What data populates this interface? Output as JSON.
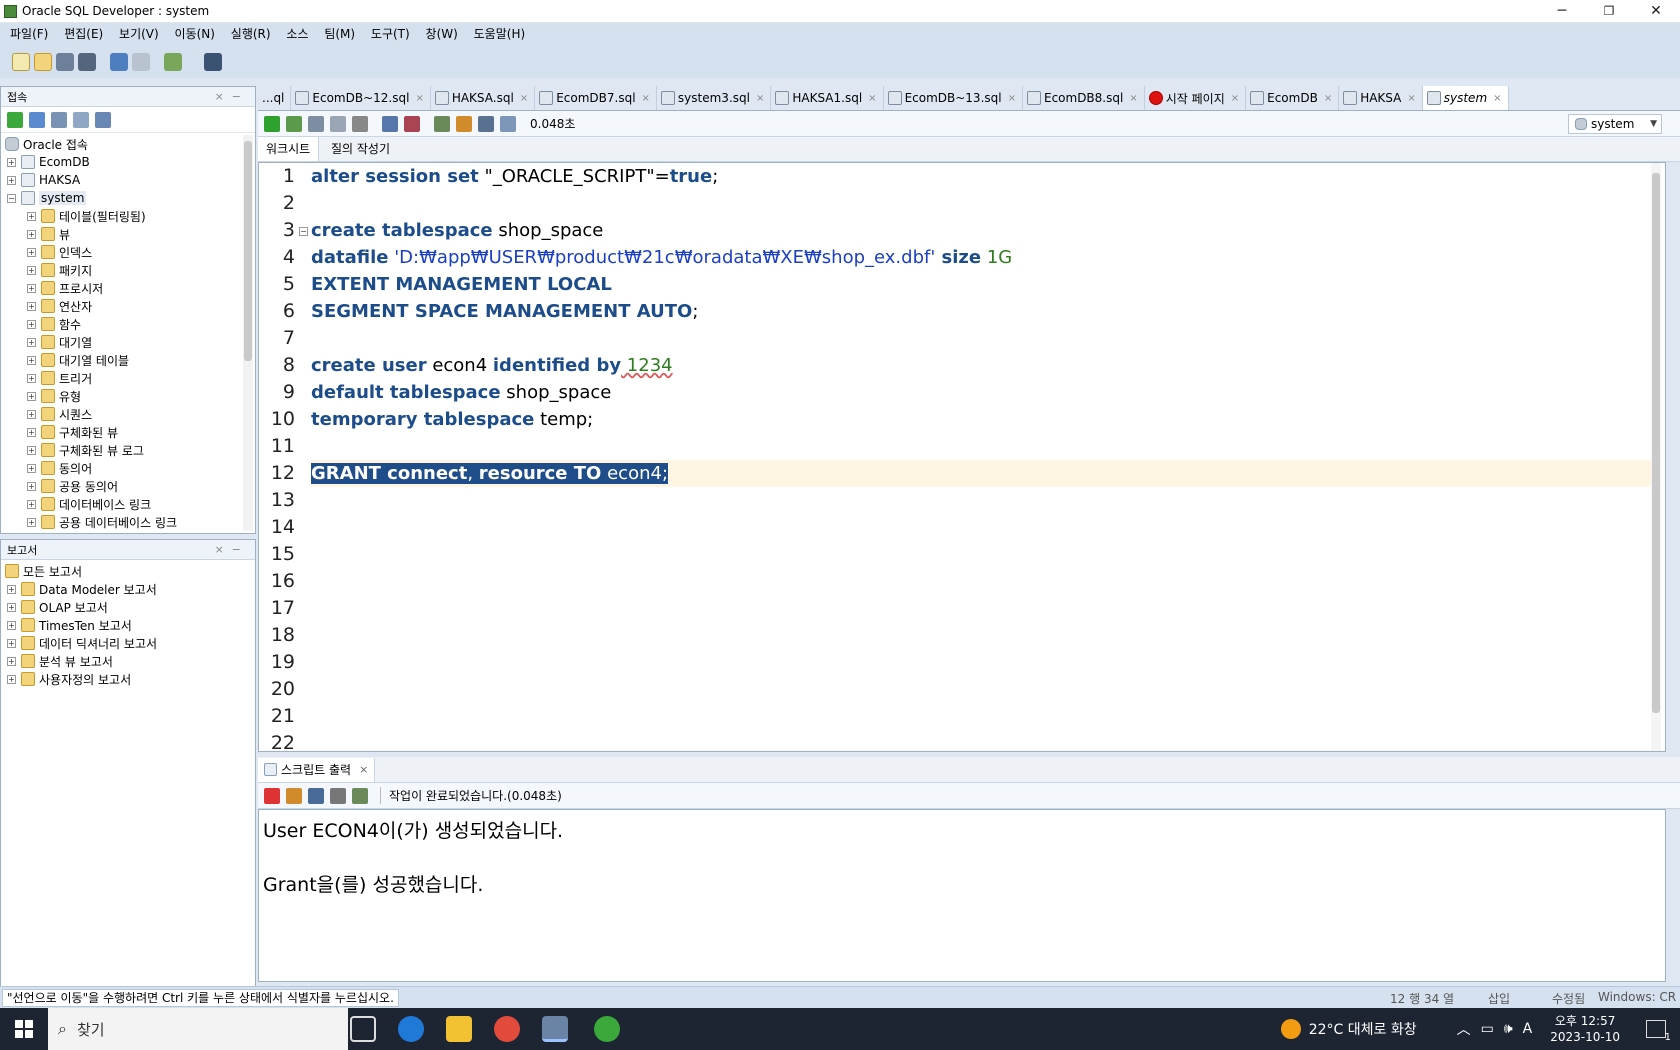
{
  "window": {
    "title": "Oracle SQL Developer : system",
    "min": "─",
    "max": "❐",
    "close": "✕"
  },
  "menu": [
    "파일(F)",
    "편집(E)",
    "보기(V)",
    "이동(N)",
    "실행(R)",
    "소스",
    "팀(M)",
    "도구(T)",
    "창(W)",
    "도움말(H)"
  ],
  "connections": {
    "header": "접속",
    "root": "Oracle 접속",
    "items": [
      "EcomDB",
      "HAKSA",
      "system"
    ],
    "children": [
      "테이블(필터링됨)",
      "뷰",
      "인덱스",
      "패키지",
      "프로시저",
      "연산자",
      "함수",
      "대기열",
      "대기열 테이블",
      "트리거",
      "유형",
      "시퀀스",
      "구체화된 뷰",
      "구체화된 뷰 로그",
      "동의어",
      "공용 동의어",
      "데이터베이스 링크",
      "공용 데이터베이스 링크"
    ]
  },
  "reports": {
    "header": "보고서",
    "root": "모든 보고서",
    "items": [
      "Data Modeler 보고서",
      "OLAP 보고서",
      "TimesTen 보고서",
      "데이터 딕셔너리 보고서",
      "분석 뷰 보고서",
      "사용자정의 보고서"
    ]
  },
  "tabs": [
    "...ql",
    "EcomDB~12.sql",
    "HAKSA.sql",
    "EcomDB7.sql",
    "system3.sql",
    "HAKSA1.sql",
    "EcomDB~13.sql",
    "EcomDB8.sql",
    "시작 페이지",
    "EcomDB",
    "HAKSA",
    "system"
  ],
  "editor_toolbar": {
    "time": "0.048초",
    "connection": "system"
  },
  "subtabs": [
    "워크시트",
    "질의 작성기"
  ],
  "line_numbers": [
    "1",
    "2",
    "3",
    "4",
    "5",
    "6",
    "7",
    "8",
    "9",
    "10",
    "11",
    "12",
    "13",
    "14",
    "15",
    "16",
    "17",
    "18",
    "19",
    "20",
    "21",
    "22"
  ],
  "code": {
    "l1": {
      "k1": "alter session set",
      "t1": " \"_ORACLE_SCRIPT\"=",
      "k2": "true",
      "t2": ";"
    },
    "l3": {
      "k1": "create tablespace",
      "t1": " shop_space"
    },
    "l4": {
      "k1": "datafile",
      "s1": " 'D:₩app₩USER₩product₩21c₩oradata₩XE₩shop_ex.dbf'",
      "k2": " size",
      "n1": " 1G"
    },
    "l5": {
      "k1": "EXTENT MANAGEMENT LOCAL"
    },
    "l6": {
      "k1": "SEGMENT SPACE MANAGEMENT AUTO",
      "t1": ";"
    },
    "l8": {
      "k1": "create user",
      "t1": " econ4 ",
      "k2": "identified by",
      "n1": " 1234"
    },
    "l9": {
      "k1": "default tablespace",
      "t1": " shop_space"
    },
    "l10": {
      "k1": "temporary tablespace",
      "t1": " temp;"
    },
    "l12": {
      "k1": "GRANT connect",
      "t1": ", ",
      "k2": "resource TO",
      "t2": " econ4;"
    }
  },
  "output": {
    "tab": "스크립트 출력",
    "status": "작업이 완료되었습니다.(0.048초)",
    "lines": [
      "User ECON4이(가) 생성되었습니다.",
      "Grant을(를) 성공했습니다."
    ]
  },
  "statusbar": {
    "message": "\"선언으로 이동\"을 수행하려면 Ctrl 키를 누른 상태에서 식별자를 누르십시오.",
    "position": "12 행 34 열",
    "mode": "삽입",
    "modified": "수정됨",
    "eol": "Windows: CR"
  },
  "taskbar": {
    "search": "찾기",
    "weather": "22°C  대체로 화창",
    "time": "오후 12:57",
    "date": "2023-10-10",
    "lang": "A",
    "notif": "1"
  },
  "colors": {
    "keyword": "#1c4d8a",
    "string": "#1a3fc4",
    "number": "#2e7d1e",
    "selection": "#1f4d8a"
  }
}
